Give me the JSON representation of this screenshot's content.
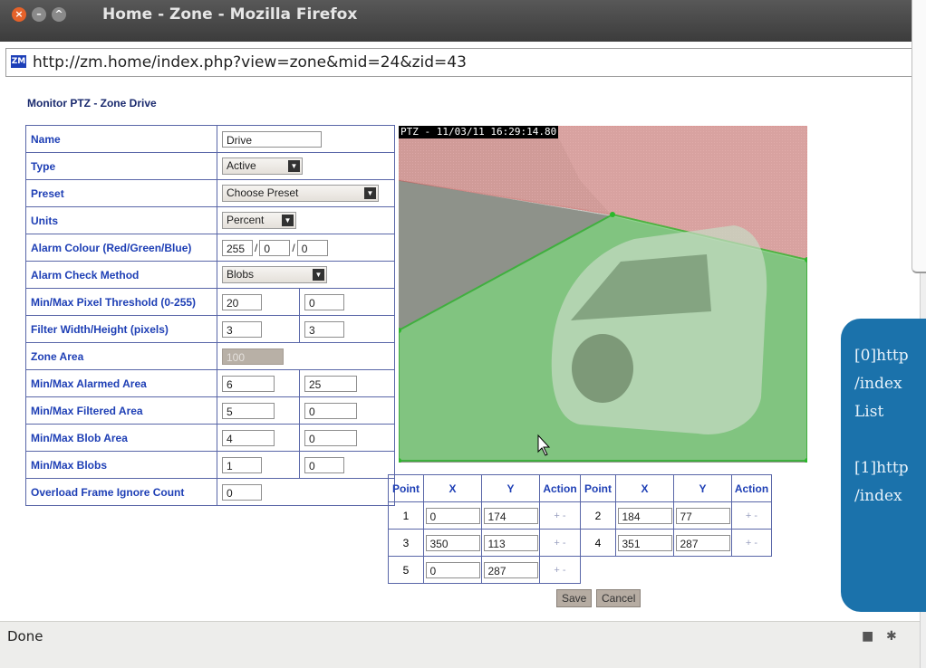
{
  "window": {
    "title": "Home - Zone - Mozilla Firefox"
  },
  "address_bar": {
    "favicon": "ZM",
    "url": "http://zm.home/index.php?view=zone&mid=24&zid=43"
  },
  "page": {
    "title": "Monitor PTZ - Zone Drive"
  },
  "zone_form": {
    "name": {
      "label": "Name",
      "value": "Drive"
    },
    "type": {
      "label": "Type",
      "value": "Active"
    },
    "preset": {
      "label": "Preset",
      "value": "Choose Preset"
    },
    "units": {
      "label": "Units",
      "value": "Percent"
    },
    "alarm_colour": {
      "label": "Alarm Colour (Red/Green/Blue)",
      "red": "255",
      "green": "0",
      "blue": "0",
      "separator": "/"
    },
    "alarm_check_method": {
      "label": "Alarm Check Method",
      "value": "Blobs"
    },
    "pixel_threshold": {
      "label": "Min/Max Pixel Threshold (0-255)",
      "min": "20",
      "max": "0"
    },
    "filter_size": {
      "label": "Filter Width/Height (pixels)",
      "width": "3",
      "height": "3"
    },
    "zone_area": {
      "label": "Zone Area",
      "value": "100"
    },
    "alarmed_area": {
      "label": "Min/Max Alarmed Area",
      "min": "6",
      "max": "25"
    },
    "filtered_area": {
      "label": "Min/Max Filtered Area",
      "min": "5",
      "max": "0"
    },
    "blob_area": {
      "label": "Min/Max Blob Area",
      "min": "4",
      "max": "0"
    },
    "blobs": {
      "label": "Min/Max Blobs",
      "min": "1",
      "max": "0"
    },
    "overload_ignore": {
      "label": "Overload Frame Ignore Count",
      "value": "0"
    }
  },
  "camera": {
    "timestamp": "PTZ - 11/03/11 16:29:14.80"
  },
  "points_table": {
    "headers": {
      "point": "Point",
      "x": "X",
      "y": "Y",
      "action": "Action"
    },
    "action_text": "+ -",
    "points": [
      {
        "point": "1",
        "x": "0",
        "y": "174"
      },
      {
        "point": "2",
        "x": "184",
        "y": "77"
      },
      {
        "point": "3",
        "x": "350",
        "y": "113"
      },
      {
        "point": "4",
        "x": "351",
        "y": "287"
      },
      {
        "point": "5",
        "x": "0",
        "y": "287"
      }
    ]
  },
  "buttons": {
    "save": "Save",
    "cancel": "Cancel"
  },
  "tooltip": {
    "lines": [
      "[0]http",
      "/index",
      "List",
      "",
      "[1]http",
      "/index"
    ]
  },
  "status_bar": {
    "text": "Done"
  },
  "colors": {
    "zone_green": "#7ed27e",
    "zone_red": "#e04848",
    "label_blue": "#1e3fb5",
    "border_blue": "#5966a8",
    "tooltip_bg": "#1b72ab"
  }
}
